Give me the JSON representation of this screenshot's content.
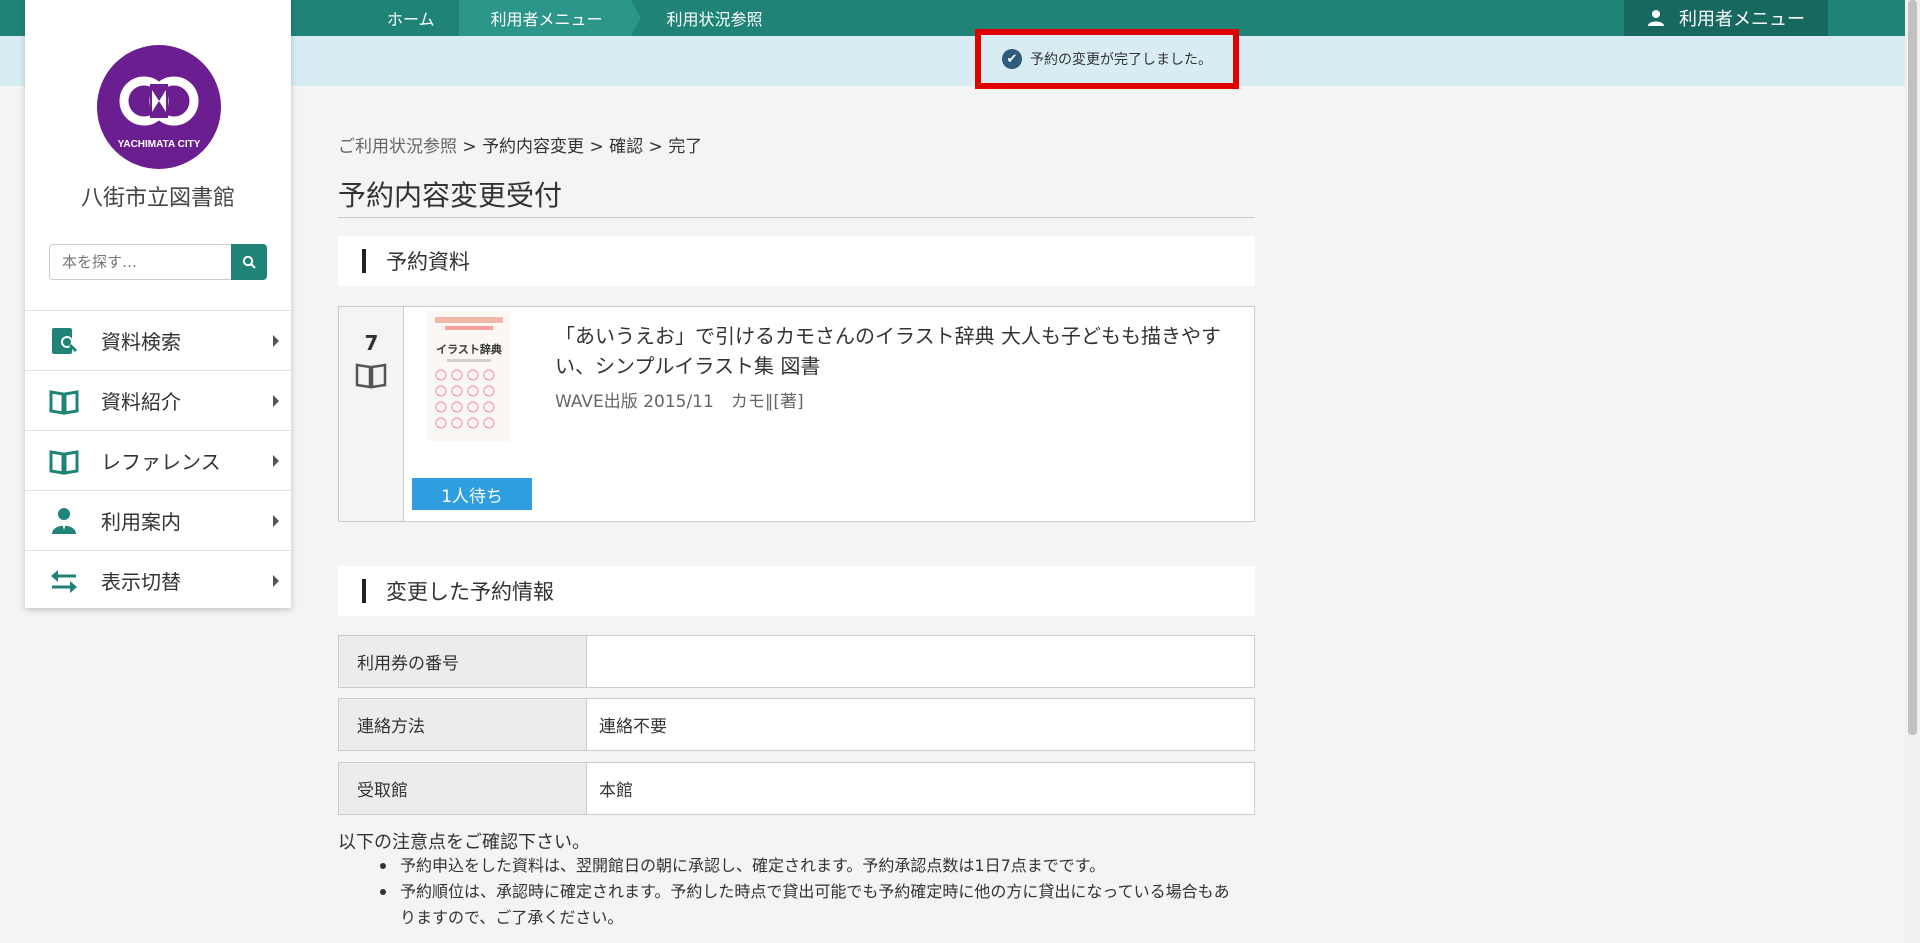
{
  "topbar": {
    "breadcrumbs": [
      "ホーム",
      "利用者メニュー",
      "利用状況参照"
    ],
    "user_menu_label": "利用者メニュー"
  },
  "notice": {
    "message": "予約の変更が完了しました。"
  },
  "sidebar": {
    "library_name": "八街市立図書館",
    "logo_text": "YACHIMATA CITY",
    "search_placeholder": "本を探す…",
    "items": [
      {
        "label": "資料検索",
        "icon": "book-search-icon"
      },
      {
        "label": "資料紹介",
        "icon": "open-book-icon"
      },
      {
        "label": "レファレンス",
        "icon": "open-book-icon"
      },
      {
        "label": "利用案内",
        "icon": "librarian-icon"
      },
      {
        "label": "表示切替",
        "icon": "switch-arrows-icon"
      }
    ]
  },
  "main": {
    "breadcrumb": {
      "link": "ご利用状況参照",
      "sep": ">",
      "steps": [
        "予約内容変更",
        "確認",
        "完了"
      ]
    },
    "page_title": "予約内容変更受付",
    "section_reserved": "予約資料",
    "item": {
      "number": "7",
      "title": "「あいうえお」で引けるカモさんのイラスト辞典 大人も子どもも描きやすい、シンプルイラスト集 図書",
      "meta": "WAVE出版 2015/11　カモ∥[著]",
      "wait": "1人待ち",
      "cover_title": "イラスト辞典"
    },
    "section_changed": "変更した予約情報",
    "info_rows": [
      {
        "key": "利用券の番号",
        "value": ""
      },
      {
        "key": "連絡方法",
        "value": "連絡不要"
      },
      {
        "key": "受取館",
        "value": "本館"
      }
    ],
    "notes_heading": "以下の注意点をご確認下さい。",
    "notes": [
      "予約申込をした資料は、翌開館日の朝に承認し、確定されます。予約承認点数は1日7点までです。",
      "予約順位は、承認時に確定されます。予約した時点で貸出可能でも予約確定時に他の方に貸出になっている場合もありますので、ご了承ください。"
    ]
  },
  "colors": {
    "teal": "#1f8377",
    "notice_bg": "#d7ecf3",
    "highlight": "#e00000",
    "badge": "#2f9ee1",
    "logo": "#6b1e8f"
  }
}
